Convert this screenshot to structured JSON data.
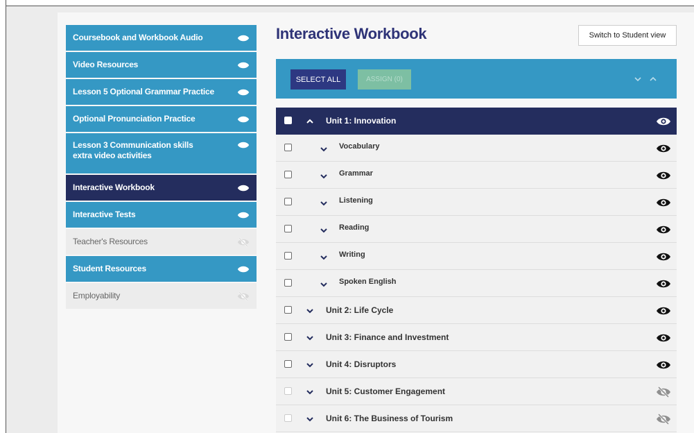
{
  "sidebar": {
    "items": [
      {
        "label": "Coursebook and Workbook Audio",
        "state": "blue",
        "icon": "eye-icon"
      },
      {
        "label": "Video Resources",
        "state": "blue",
        "icon": "eye-icon"
      },
      {
        "label": "Lesson 5 Optional Grammar Practice",
        "state": "blue",
        "icon": "eye-icon"
      },
      {
        "label": "Optional Pronunciation Practice",
        "state": "blue",
        "icon": "eye-icon"
      },
      {
        "label": "Lesson 3 Communication skills extra video activities",
        "state": "blue",
        "icon": "eye-icon"
      },
      {
        "label": "Interactive Workbook",
        "state": "active",
        "icon": "eye-icon"
      },
      {
        "label": "Interactive Tests",
        "state": "blue",
        "icon": "eye-icon"
      },
      {
        "label": "Teacher's Resources",
        "state": "grey",
        "icon": "eye-off-icon"
      },
      {
        "label": "Student Resources",
        "state": "blue",
        "icon": "eye-icon"
      },
      {
        "label": "Employability",
        "state": "grey",
        "icon": "eye-off-icon"
      }
    ]
  },
  "main": {
    "title": "Interactive Workbook",
    "switch_label": "Switch to Student view",
    "toolbar": {
      "select_all": "SELECT ALL",
      "assign": "ASSIGN (0)"
    },
    "rows": [
      {
        "label": "Unit 1: Innovation",
        "kind": "header",
        "icon": "eye-icon"
      },
      {
        "label": "Vocabulary",
        "kind": "sub",
        "icon": "eye-icon"
      },
      {
        "label": "Grammar",
        "kind": "sub",
        "icon": "eye-icon"
      },
      {
        "label": "Listening",
        "kind": "sub",
        "icon": "eye-icon"
      },
      {
        "label": "Reading",
        "kind": "sub",
        "icon": "eye-icon"
      },
      {
        "label": "Writing",
        "kind": "sub",
        "icon": "eye-icon"
      },
      {
        "label": "Spoken English",
        "kind": "sub",
        "icon": "eye-icon"
      },
      {
        "label": "Unit 2: Life Cycle",
        "kind": "unit",
        "icon": "eye-icon"
      },
      {
        "label": "Unit 3: Finance and Investment",
        "kind": "unit",
        "icon": "eye-icon"
      },
      {
        "label": "Unit 4: Disruptors",
        "kind": "unit",
        "icon": "eye-icon"
      },
      {
        "label": "Unit 5: Customer Engagement",
        "kind": "unit",
        "icon": "eye-off-icon"
      },
      {
        "label": "Unit 6: The Business of Tourism",
        "kind": "unit",
        "icon": "eye-off-icon"
      }
    ]
  },
  "colors": {
    "sidebar_blue": "#3598c4",
    "active_navy": "#242d5e",
    "title_navy": "#2e3377",
    "select_btn": "#2d3882",
    "assign_btn": "#7dbfa3"
  }
}
